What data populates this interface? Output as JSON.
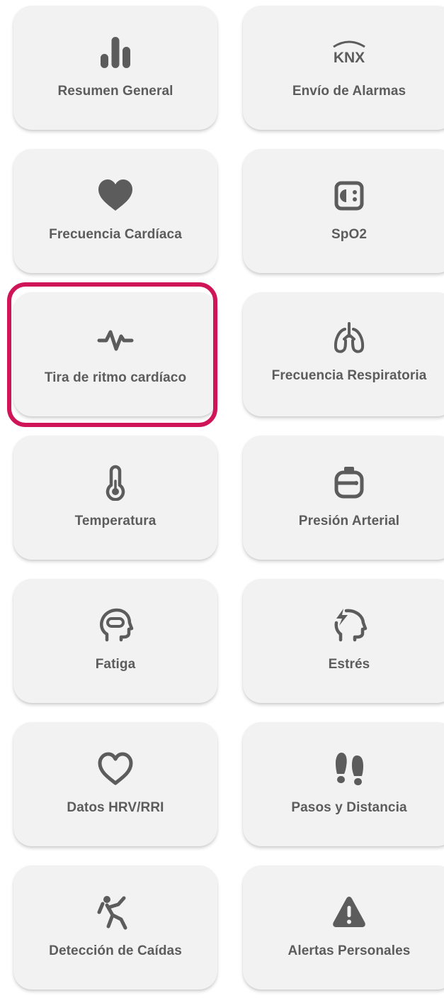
{
  "accent_color": "#cf1458",
  "icon_color": "#5c5c5c",
  "tile_color": "#f2f2f2",
  "menu": {
    "selected_index": 4,
    "tiles": [
      {
        "label": "Resumen General",
        "icon": "bar-chart-icon"
      },
      {
        "label": "Envío de Alarmas",
        "icon": "knx-logo-icon",
        "icon_text": "KNX"
      },
      {
        "label": "Frecuencia Cardíaca",
        "icon": "heart-filled-icon"
      },
      {
        "label": "SpO2",
        "icon": "spo2-icon"
      },
      {
        "label": "Tira de ritmo cardíaco",
        "icon": "heart-rhythm-icon"
      },
      {
        "label": "Frecuencia Respiratoria",
        "icon": "lungs-icon"
      },
      {
        "label": "Temperatura",
        "icon": "thermometer-icon"
      },
      {
        "label": "Presión Arterial",
        "icon": "blood-pressure-icon"
      },
      {
        "label": "Fatiga",
        "icon": "head-fatigue-icon"
      },
      {
        "label": "Estrés",
        "icon": "head-stress-icon"
      },
      {
        "label": "Datos HRV/RRI",
        "icon": "heart-outline-icon"
      },
      {
        "label": "Pasos y Distancia",
        "icon": "footprints-icon"
      },
      {
        "label": "Detección de Caídas",
        "icon": "fall-detection-icon"
      },
      {
        "label": "Alertas Personales",
        "icon": "warning-icon"
      }
    ]
  }
}
